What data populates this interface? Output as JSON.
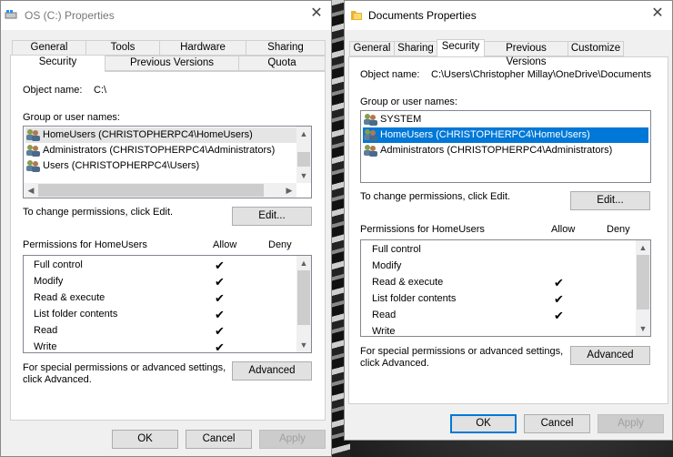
{
  "left": {
    "title": "OS (C:) Properties",
    "tabs_row1": [
      "General",
      "Tools",
      "Hardware",
      "Sharing"
    ],
    "tabs_row2": [
      "Security",
      "Previous Versions",
      "Quota"
    ],
    "object_name_label": "Object name:",
    "object_name_value": "C:\\",
    "group_label": "Group or user names:",
    "users": [
      "HomeUsers (CHRISTOPHERPC4\\HomeUsers)",
      "Administrators (CHRISTOPHERPC4\\Administrators)",
      "Users (CHRISTOPHERPC4\\Users)"
    ],
    "change_text": "To change permissions, click Edit.",
    "edit_button": "Edit...",
    "perm_label": "Permissions for HomeUsers",
    "allow": "Allow",
    "deny": "Deny",
    "permissions": [
      {
        "name": "Full control",
        "allow": true
      },
      {
        "name": "Modify",
        "allow": true
      },
      {
        "name": "Read & execute",
        "allow": true
      },
      {
        "name": "List folder contents",
        "allow": true
      },
      {
        "name": "Read",
        "allow": true
      },
      {
        "name": "Write",
        "allow": true
      }
    ],
    "special_text_1": "For special permissions or advanced settings,",
    "special_text_2": "click Advanced.",
    "advanced_button": "Advanced",
    "ok": "OK",
    "cancel": "Cancel",
    "apply": "Apply"
  },
  "right": {
    "title": "Documents Properties",
    "tabs": [
      "General",
      "Sharing",
      "Security",
      "Previous Versions",
      "Customize"
    ],
    "object_name_label": "Object name:",
    "object_name_value": "C:\\Users\\Christopher Millay\\OneDrive\\Documents",
    "group_label": "Group or user names:",
    "users": [
      "SYSTEM",
      "HomeUsers (CHRISTOPHERPC4\\HomeUsers)",
      "Administrators (CHRISTOPHERPC4\\Administrators)"
    ],
    "change_text": "To change permissions, click Edit.",
    "edit_button": "Edit...",
    "perm_label": "Permissions for HomeUsers",
    "allow": "Allow",
    "deny": "Deny",
    "permissions": [
      {
        "name": "Full control",
        "allow": false
      },
      {
        "name": "Modify",
        "allow": false
      },
      {
        "name": "Read & execute",
        "allow": true
      },
      {
        "name": "List folder contents",
        "allow": true
      },
      {
        "name": "Read",
        "allow": true
      },
      {
        "name": "Write",
        "allow": false
      }
    ],
    "special_text_1": "For special permissions or advanced settings,",
    "special_text_2": "click Advanced.",
    "advanced_button": "Advanced",
    "ok": "OK",
    "cancel": "Cancel",
    "apply": "Apply"
  },
  "checkmark": "✔",
  "accent": "#0078d7"
}
